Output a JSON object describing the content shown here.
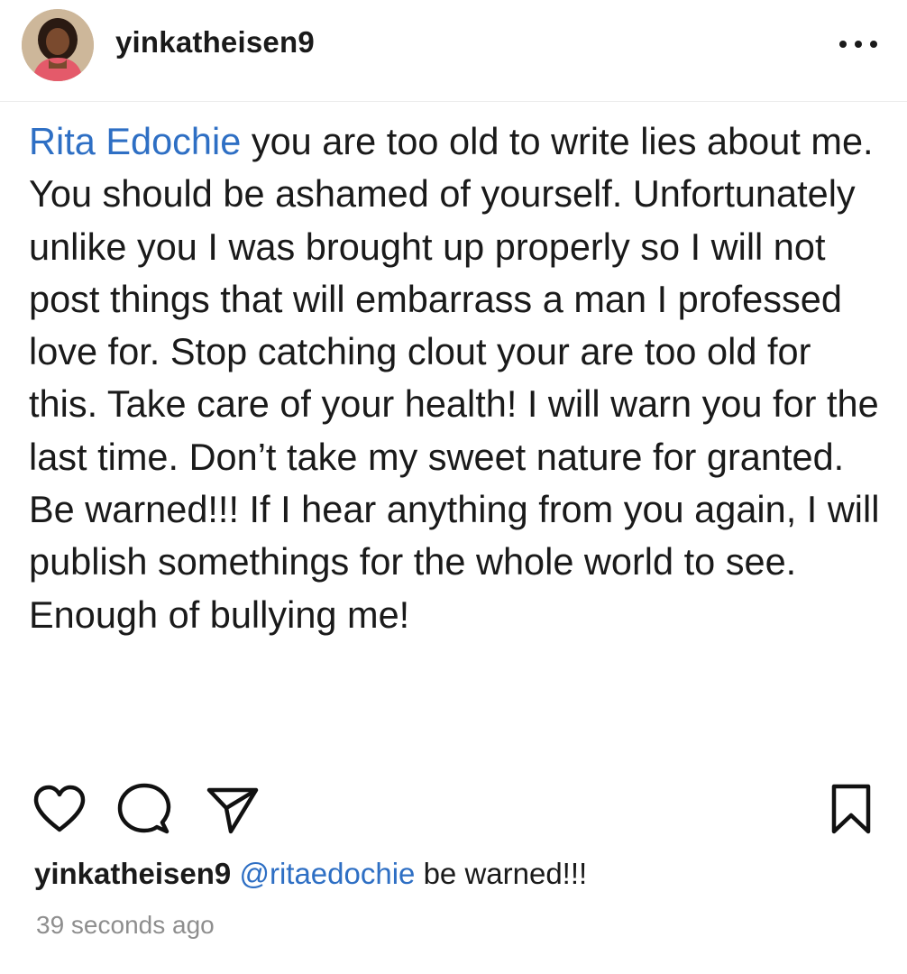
{
  "post": {
    "header": {
      "username": "yinkatheisen9",
      "avatar_icon": "profile-photo",
      "more_icon": "more-horizontal-icon"
    },
    "caption": {
      "mention": "Rita Edochie",
      "text": " you are too old to write lies about me. You should be ashamed of yourself. Unfortunately unlike you I was brought up properly so I will not post things that will embarrass a man I professed love for. Stop catching clout your are too old for this. Take care of your health! I will warn you for the last time. Don’t take my sweet nature for granted. Be warned!!! If I hear anything from you again, I will publish somethings for the whole world to see. Enough of bullying me!"
    },
    "actions": {
      "like_icon": "heart-icon",
      "comment_icon": "comment-icon",
      "share_icon": "share-icon",
      "save_icon": "bookmark-icon"
    },
    "comment": {
      "username": "yinkatheisen9",
      "mention": "@ritaedochie",
      "text": " be warned!!!"
    },
    "timestamp": "39 seconds ago"
  },
  "colors": {
    "mention": "#2e6fc4",
    "text": "#1a1a1a",
    "muted": "#8e8e8e"
  }
}
